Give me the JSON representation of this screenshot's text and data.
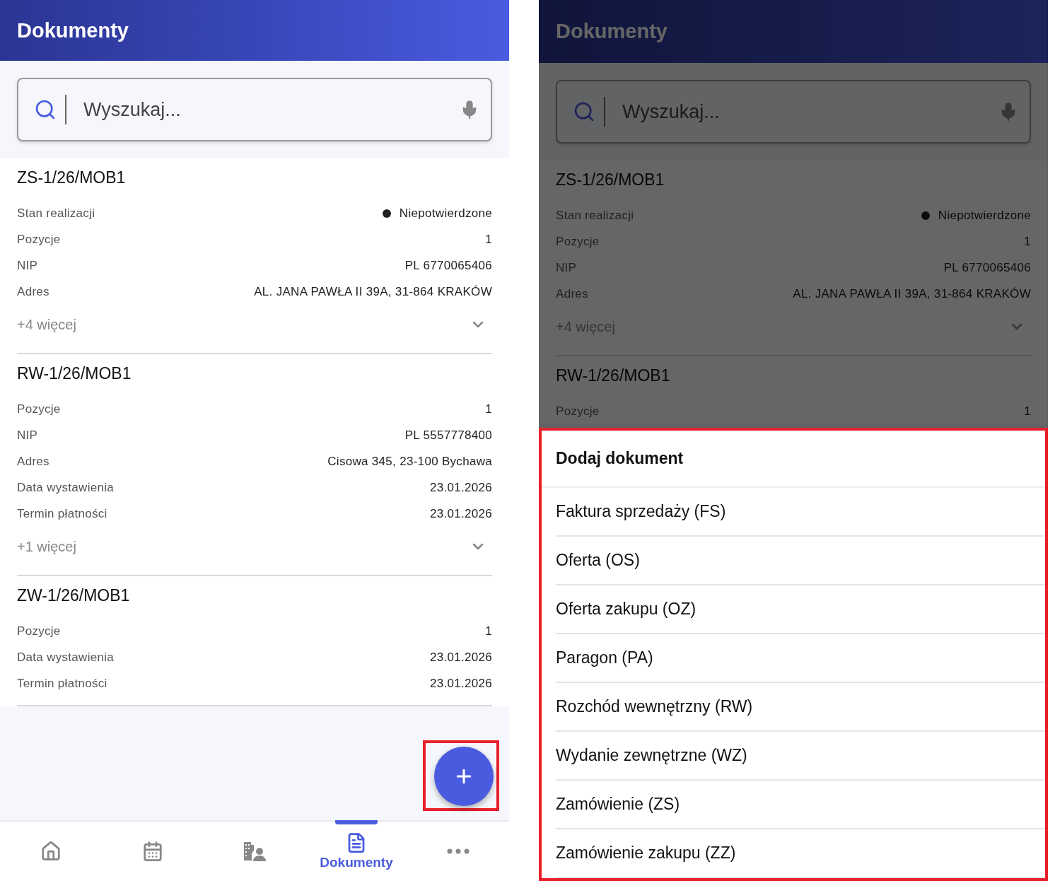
{
  "screens": [
    {
      "header": {
        "title": "Dokumenty"
      },
      "search": {
        "placeholder": "Wyszukaj..."
      },
      "documents": [
        {
          "number": "ZS-1/26/MOB1",
          "fields": [
            {
              "label": "Stan realizacji",
              "value": "Niepotwierdzone",
              "kind": "status"
            },
            {
              "label": "Pozycje",
              "value": "1",
              "kind": "text"
            },
            {
              "label": "NIP",
              "value": "PL 6770065406",
              "kind": "text"
            },
            {
              "label": "Adres",
              "value": "AL. JANA PAWŁA II 39A, 31-864 KRAKÓW",
              "kind": "text"
            }
          ],
          "more": "+4 więcej"
        },
        {
          "number": "RW-1/26/MOB1",
          "fields": [
            {
              "label": "Pozycje",
              "value": "1",
              "kind": "text"
            },
            {
              "label": "NIP",
              "value": "PL 5557778400",
              "kind": "text"
            },
            {
              "label": "Adres",
              "value": "Cisowa 345, 23-100 Bychawa",
              "kind": "text"
            },
            {
              "label": "Data wystawienia",
              "value": "23.01.2026",
              "kind": "text"
            },
            {
              "label": "Termin płatności",
              "value": "23.01.2026",
              "kind": "text"
            }
          ],
          "more": "+1 więcej"
        },
        {
          "number": "ZW-1/26/MOB1",
          "fields": [
            {
              "label": "Pozycje",
              "value": "1",
              "kind": "text"
            },
            {
              "label": "Data wystawienia",
              "value": "23.01.2026",
              "kind": "text"
            },
            {
              "label": "Termin płatności",
              "value": "23.01.2026",
              "kind": "text"
            }
          ]
        }
      ],
      "fab": {
        "highlighted": true
      },
      "nav": [
        {
          "kind": "home",
          "selected": false
        },
        {
          "kind": "calendar",
          "selected": false
        },
        {
          "kind": "contractors",
          "selected": false
        },
        {
          "kind": "documents",
          "label": "Dokumenty",
          "selected": true
        },
        {
          "kind": "more",
          "selected": false
        }
      ]
    },
    {
      "dimmed": true,
      "header": {
        "title": "Dokumenty"
      },
      "search": {
        "placeholder": "Wyszukaj..."
      },
      "documents": [
        {
          "number": "ZS-1/26/MOB1",
          "fields": [
            {
              "label": "Stan realizacji",
              "value": "Niepotwierdzone",
              "kind": "status"
            },
            {
              "label": "Pozycje",
              "value": "1",
              "kind": "text"
            },
            {
              "label": "NIP",
              "value": "PL 6770065406",
              "kind": "text"
            },
            {
              "label": "Adres",
              "value": "AL. JANA PAWŁA II 39A, 31-864 KRAKÓW",
              "kind": "text"
            }
          ],
          "more": "+4 więcej"
        },
        {
          "number": "RW-1/26/MOB1",
          "fields": [
            {
              "label": "Pozycje",
              "value": "1",
              "kind": "text"
            }
          ]
        }
      ],
      "sheet": {
        "title": "Dodaj dokument",
        "highlighted": true,
        "items": [
          "Faktura sprzedaży (FS)",
          "Oferta (OS)",
          "Oferta zakupu (OZ)",
          "Paragon (PA)",
          "Rozchód wewnętrzny (RW)",
          "Wydanie zewnętrzne (WZ)",
          "Zamówienie (ZS)",
          "Zamówienie zakupu (ZZ)"
        ]
      }
    }
  ]
}
